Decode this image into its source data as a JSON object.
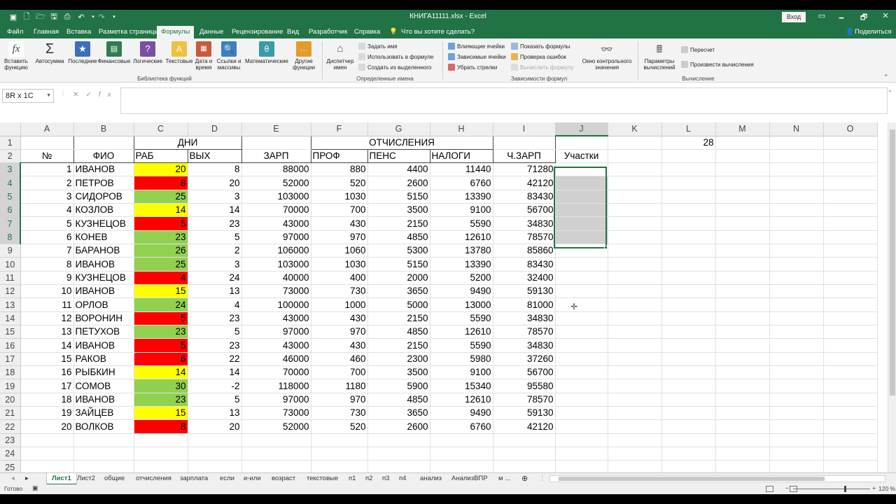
{
  "window": {
    "title": "КНИГА11111.xlsx  -  Excel",
    "signin": "Вход",
    "min": "🗕",
    "max": "🗗",
    "close": "✕"
  },
  "menu": {
    "file": "Файл",
    "tabs": [
      "Главная",
      "Вставка",
      "Разметка страницы",
      "Формулы",
      "Данные",
      "Рецензирование",
      "Вид",
      "Разработчик",
      "Справка"
    ],
    "active": "Формулы",
    "tellme": "Что вы хотите сделать?",
    "share": "Поделиться"
  },
  "ribbon": {
    "insert_function": "Вставить функцию",
    "autosum": "Автосумма",
    "recent": "Последние",
    "financial": "Финансовые",
    "logical": "Логические",
    "text": "Текстовые",
    "datetime": "Дата и время",
    "lookup": "Ссылки и массивы",
    "math": "Математические",
    "other": "Другие функции",
    "group_library": "Библиотека функций",
    "name_manager": "Диспетчер имен",
    "define_name": "Задать имя",
    "use_in_formula": "Использовать в формуле",
    "create_from_sel": "Создать из выделенного",
    "group_names": "Определенные имена",
    "trace_precedents": "Влияющие ячейки",
    "trace_dependents": "Зависимые ячейки",
    "remove_arrows": "Убрать стрелки",
    "show_formulas": "Показать формулы",
    "error_check": "Проверка ошибок",
    "evaluate": "Вычислить формулу",
    "watch": "Окно контрольного значения",
    "group_audit": "Зависимости формул",
    "calc_options": "Параметры вычислений",
    "calc_now": "Пересчет",
    "calc_sheet": "Произвести вычисления",
    "group_calc": "Вычисление"
  },
  "formula_bar": {
    "name_box": "8R x 1C",
    "value": ""
  },
  "columns": [
    "A",
    "B",
    "C",
    "D",
    "E",
    "F",
    "G",
    "H",
    "I",
    "J",
    "K",
    "L",
    "M",
    "N",
    "O"
  ],
  "header_row1": {
    "C": "ДНИ",
    "F": "ОТЧИСЛЕНИЯ",
    "L": "28"
  },
  "header_row2": [
    "№",
    "ФИО",
    "РАБ",
    "ВЫХ",
    "ЗАРП",
    "ПРОФ",
    "ПЕНС",
    "НАЛОГИ",
    "Ч.ЗАРП",
    "Участки"
  ],
  "rows": [
    {
      "n": "1",
      "name": "ИВАНОВ",
      "rab": "20",
      "c": "y",
      "vyh": "8",
      "zarp": "88000",
      "prof": "880",
      "pens": "4400",
      "nal": "11440",
      "ch": "71280"
    },
    {
      "n": "2",
      "name": "ПЕТРОВ",
      "rab": "8",
      "c": "r",
      "vyh": "20",
      "zarp": "52000",
      "prof": "520",
      "pens": "2600",
      "nal": "6760",
      "ch": "42120"
    },
    {
      "n": "3",
      "name": "СИДОРОВ",
      "rab": "25",
      "c": "g",
      "vyh": "3",
      "zarp": "103000",
      "prof": "1030",
      "pens": "5150",
      "nal": "13390",
      "ch": "83430"
    },
    {
      "n": "4",
      "name": "КОЗЛОВ",
      "rab": "14",
      "c": "y",
      "vyh": "14",
      "zarp": "70000",
      "prof": "700",
      "pens": "3500",
      "nal": "9100",
      "ch": "56700"
    },
    {
      "n": "5",
      "name": "КУЗНЕЦОВ",
      "rab": "5",
      "c": "r",
      "vyh": "23",
      "zarp": "43000",
      "prof": "430",
      "pens": "2150",
      "nal": "5590",
      "ch": "34830"
    },
    {
      "n": "6",
      "name": "КОНЕВ",
      "rab": "23",
      "c": "g",
      "vyh": "5",
      "zarp": "97000",
      "prof": "970",
      "pens": "4850",
      "nal": "12610",
      "ch": "78570"
    },
    {
      "n": "7",
      "name": "БАРАНОВ",
      "rab": "26",
      "c": "g",
      "vyh": "2",
      "zarp": "106000",
      "prof": "1060",
      "pens": "5300",
      "nal": "13780",
      "ch": "85860"
    },
    {
      "n": "8",
      "name": "ИВАНОВ",
      "rab": "25",
      "c": "g",
      "vyh": "3",
      "zarp": "103000",
      "prof": "1030",
      "pens": "5150",
      "nal": "13390",
      "ch": "83430"
    },
    {
      "n": "9",
      "name": "КУЗНЕЦОВ",
      "rab": "4",
      "c": "r",
      "vyh": "24",
      "zarp": "40000",
      "prof": "400",
      "pens": "2000",
      "nal": "5200",
      "ch": "32400"
    },
    {
      "n": "10",
      "name": "ИВАНОВ",
      "rab": "15",
      "c": "y",
      "vyh": "13",
      "zarp": "73000",
      "prof": "730",
      "pens": "3650",
      "nal": "9490",
      "ch": "59130"
    },
    {
      "n": "11",
      "name": "ОРЛОВ",
      "rab": "24",
      "c": "g",
      "vyh": "4",
      "zarp": "100000",
      "prof": "1000",
      "pens": "5000",
      "nal": "13000",
      "ch": "81000"
    },
    {
      "n": "12",
      "name": "ВОРОНИН",
      "rab": "5",
      "c": "r",
      "vyh": "23",
      "zarp": "43000",
      "prof": "430",
      "pens": "2150",
      "nal": "5590",
      "ch": "34830"
    },
    {
      "n": "13",
      "name": "ПЕТУХОВ",
      "rab": "23",
      "c": "g",
      "vyh": "5",
      "zarp": "97000",
      "prof": "970",
      "pens": "4850",
      "nal": "12610",
      "ch": "78570"
    },
    {
      "n": "14",
      "name": "ИВАНОВ",
      "rab": "5",
      "c": "r",
      "vyh": "23",
      "zarp": "43000",
      "prof": "430",
      "pens": "2150",
      "nal": "5590",
      "ch": "34830"
    },
    {
      "n": "15",
      "name": "РАКОВ",
      "rab": "6",
      "c": "r",
      "vyh": "22",
      "zarp": "46000",
      "prof": "460",
      "pens": "2300",
      "nal": "5980",
      "ch": "37260"
    },
    {
      "n": "16",
      "name": "РЫБКИН",
      "rab": "14",
      "c": "y",
      "vyh": "14",
      "zarp": "70000",
      "prof": "700",
      "pens": "3500",
      "nal": "9100",
      "ch": "56700"
    },
    {
      "n": "17",
      "name": "СОМОВ",
      "rab": "30",
      "c": "g",
      "vyh": "-2",
      "zarp": "118000",
      "prof": "1180",
      "pens": "5900",
      "nal": "15340",
      "ch": "95580"
    },
    {
      "n": "18",
      "name": "ИВАНОВ",
      "rab": "23",
      "c": "g",
      "vyh": "5",
      "zarp": "97000",
      "prof": "970",
      "pens": "4850",
      "nal": "12610",
      "ch": "78570"
    },
    {
      "n": "19",
      "name": "ЗАЙЦЕВ",
      "rab": "15",
      "c": "y",
      "vyh": "13",
      "zarp": "73000",
      "prof": "730",
      "pens": "3650",
      "nal": "9490",
      "ch": "59130"
    },
    {
      "n": "20",
      "name": "ВОЛКОВ",
      "rab": "8",
      "c": "r",
      "vyh": "20",
      "zarp": "52000",
      "prof": "520",
      "pens": "2600",
      "nal": "6760",
      "ch": "42120"
    }
  ],
  "sheet_tabs": [
    "Лист1",
    "Лист2",
    "общие",
    "отчисления",
    "зарплата",
    "если",
    "и-или",
    "возраст",
    "текстовые",
    "п1",
    "п2",
    "п3",
    "п4",
    "анализ",
    "АнализВПР",
    "м ..."
  ],
  "active_sheet": "Лист1",
  "status": {
    "ready": "Готово",
    "zoom": "120 %"
  },
  "colors": {
    "accent": "#217346",
    "yellow": "#ffff00",
    "red": "#ff0000",
    "green": "#92d050"
  }
}
